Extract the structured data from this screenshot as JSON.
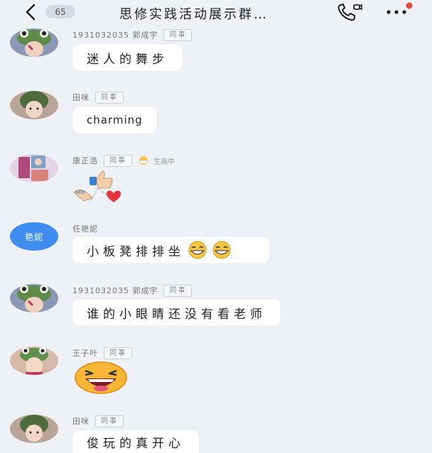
{
  "header": {
    "back_icon": "chevron-left-icon",
    "unread_count": "65",
    "title": "思修实践活动展示群…",
    "call_icon": "phone-call-icon",
    "more_icon": "more-dots-icon",
    "accent": "#e24a3b"
  },
  "messages": [
    {
      "sender": "1931032035 郭成宇",
      "role": "同事",
      "text": "迷人的舞步",
      "avatar": "frog-hat-avatar"
    },
    {
      "sender": "田咪",
      "role": "同事",
      "text": "charming",
      "avatar": "girl-avatar"
    },
    {
      "sender": "康正浩",
      "role": "同事",
      "status": "生病中",
      "sticker": "thumbs-heart-sticker",
      "avatar": "collage-avatar"
    },
    {
      "sender": "任艳妮",
      "avatar_text": "艳妮",
      "text": "小板凳排排坐",
      "emoji": [
        "grin-emoji",
        "grin-emoji"
      ]
    },
    {
      "sender": "1931032035 郭成宇",
      "role": "同事",
      "text": "谁的小眼睛还没有看老师",
      "avatar": "frog-hat-avatar"
    },
    {
      "sender": "王子叶",
      "role": "同事",
      "sticker": "laughing-face-sticker",
      "avatar": "frog-headband-avatar"
    },
    {
      "sender": "田咪",
      "role": "同事",
      "text": "俊玩的真开心",
      "avatar": "girl-avatar"
    }
  ]
}
